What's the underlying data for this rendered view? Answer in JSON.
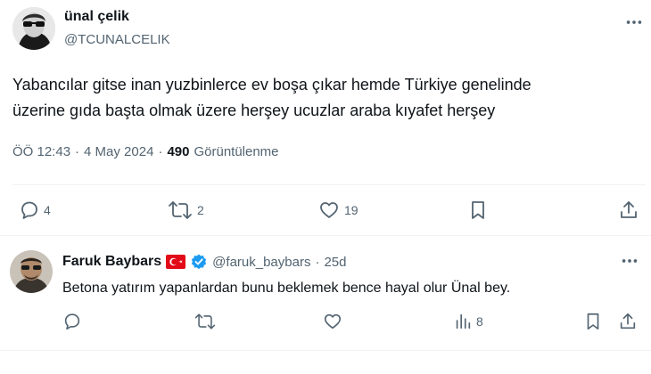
{
  "tweet": {
    "author_name": "ünal çelik",
    "author_handle": "@TCUNALCELIK",
    "text_line1": "Yabancılar gitse inan yuzbinlerce ev boşa çıkar hemde Türkiye genelinde",
    "text_line2": "üzerine gıda başta olmak üzere herşey ucuzlar araba kıyafet herşey",
    "time": "ÖÖ 12:43",
    "date_sep": "·",
    "date": "4 May 2024",
    "views_sep": "·",
    "views_count": "490",
    "views_label": "Görüntülenme",
    "actions": {
      "reply_count": "4",
      "retweet_count": "2",
      "like_count": "19"
    }
  },
  "reply": {
    "author_name": "Faruk Baybars",
    "author_handle": "@faruk_baybars",
    "time_sep": "·",
    "time": "25d",
    "text": "Betona yatırım yapanlardan bunu beklemek bence hayal olur Ünal bey.",
    "actions": {
      "views_count": "8"
    }
  },
  "icons": {
    "more": "more-horizontal-icon",
    "reply": "reply-icon",
    "retweet": "retweet-icon",
    "like": "heart-icon",
    "bookmark": "bookmark-icon",
    "share": "share-icon",
    "analytics": "analytics-icon",
    "verified": "verified-badge-icon",
    "flag": "turkey-flag-icon"
  },
  "colors": {
    "text": "#0f1419",
    "muted": "#536471",
    "verified": "#1d9bf0",
    "divider": "#eff3f4",
    "flag_red": "#e30a17"
  }
}
